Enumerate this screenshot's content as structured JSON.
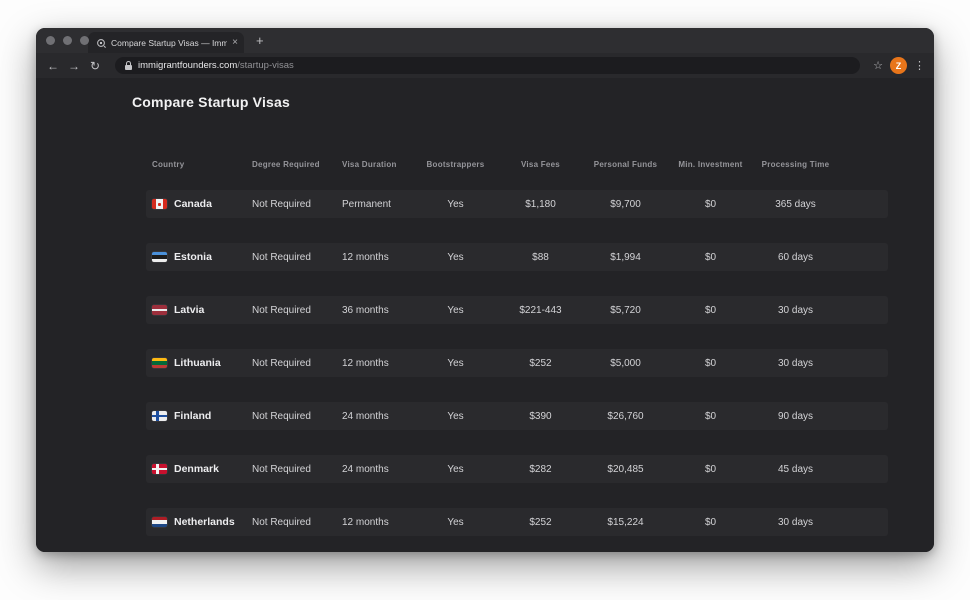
{
  "browser": {
    "tab": {
      "title": "Compare Startup Visas — Immig",
      "close_icon": "×",
      "new_tab_icon": "+"
    },
    "toolbar": {
      "back_icon": "←",
      "forward_icon": "→",
      "reload_icon": "↻",
      "star_icon": "☆",
      "menu_icon": "⋮",
      "avatar_initial": "Z",
      "avatar_color": "#e8751a"
    },
    "url": {
      "domain": "immigrantfounders.com",
      "path": "/startup-visas"
    }
  },
  "page": {
    "title": "Compare Startup Visas"
  },
  "table": {
    "headers": [
      "Country",
      "Degree Required",
      "Visa Duration",
      "Bootstrappers",
      "Visa Fees",
      "Personal Funds",
      "Min. Investment",
      "Processing Time"
    ],
    "fields": [
      "degree_required",
      "visa_duration",
      "bootstrappers",
      "visa_fees",
      "personal_funds",
      "min_investment",
      "processing_time"
    ],
    "rows": [
      {
        "country": "Canada",
        "flag": {
          "type": "v",
          "stripes": [
            "#d52b1e",
            "#f2f2f2",
            "#d52b1e"
          ],
          "weights": [
            1,
            1.7,
            1
          ],
          "emblem": "#d52b1e"
        },
        "degree_required": "Not Required",
        "visa_duration": "Permanent",
        "bootstrappers": "Yes",
        "visa_fees": "$1,180",
        "personal_funds": "$9,700",
        "min_investment": "$0",
        "processing_time": "365 days"
      },
      {
        "country": "Estonia",
        "flag": {
          "type": "h",
          "stripes": [
            "#4a90d9",
            "#1c1c1c",
            "#ededed"
          ]
        },
        "degree_required": "Not Required",
        "visa_duration": "12 months",
        "bootstrappers": "Yes",
        "visa_fees": "$88",
        "personal_funds": "$1,994",
        "min_investment": "$0",
        "processing_time": "60 days"
      },
      {
        "country": "Latvia",
        "flag": {
          "type": "h",
          "stripes": [
            "#9d2f3c",
            "#ededed",
            "#9d2f3c"
          ],
          "weights": [
            2,
            1,
            2
          ]
        },
        "degree_required": "Not Required",
        "visa_duration": "36 months",
        "bootstrappers": "Yes",
        "visa_fees": "$221-443",
        "personal_funds": "$5,720",
        "min_investment": "$0",
        "processing_time": "30 days"
      },
      {
        "country": "Lithuania",
        "flag": {
          "type": "h",
          "stripes": [
            "#fdb913",
            "#046a38",
            "#be3a34"
          ]
        },
        "degree_required": "Not Required",
        "visa_duration": "12 months",
        "bootstrappers": "Yes",
        "visa_fees": "$252",
        "personal_funds": "$5,000",
        "min_investment": "$0",
        "processing_time": "30 days"
      },
      {
        "country": "Finland",
        "flag": {
          "type": "cross",
          "bg": "#ededed",
          "cross": "#1f4f9e"
        },
        "degree_required": "Not Required",
        "visa_duration": "24 months",
        "bootstrappers": "Yes",
        "visa_fees": "$390",
        "personal_funds": "$26,760",
        "min_investment": "$0",
        "processing_time": "90 days"
      },
      {
        "country": "Denmark",
        "flag": {
          "type": "cross",
          "bg": "#c8102e",
          "cross": "#f2f2f2"
        },
        "degree_required": "Not Required",
        "visa_duration": "24 months",
        "bootstrappers": "Yes",
        "visa_fees": "$282",
        "personal_funds": "$20,485",
        "min_investment": "$0",
        "processing_time": "45 days"
      },
      {
        "country": "Netherlands",
        "flag": {
          "type": "h",
          "stripes": [
            "#ad1d25",
            "#f2f2f2",
            "#1e4785"
          ]
        },
        "degree_required": "Not Required",
        "visa_duration": "12 months",
        "bootstrappers": "Yes",
        "visa_fees": "$252",
        "personal_funds": "$15,224",
        "min_investment": "$0",
        "processing_time": "30 days"
      }
    ]
  }
}
